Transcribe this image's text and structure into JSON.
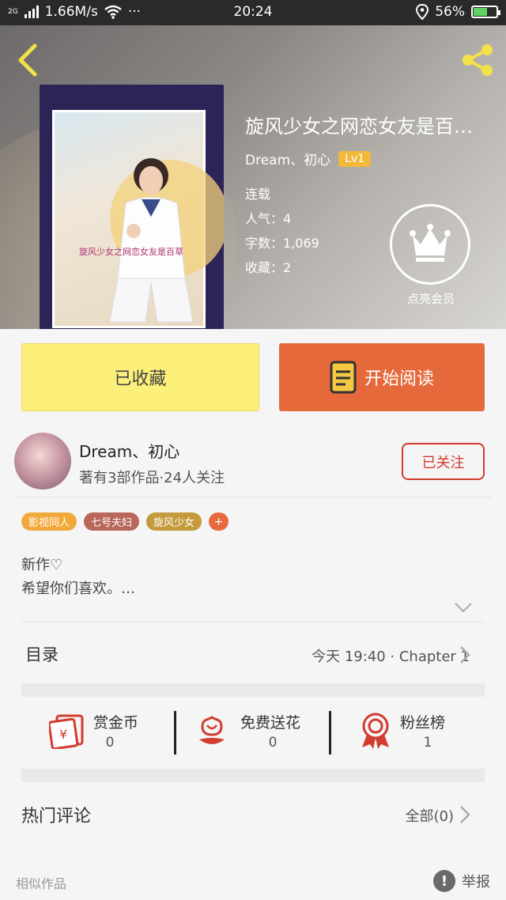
{
  "status_bar": {
    "network": "2G",
    "speed": "1.66M/s",
    "more": "···",
    "time": "20:24",
    "battery": "56%"
  },
  "book": {
    "title": "旋风少女之网恋女友是百…",
    "author": "Dream、初心",
    "level": "Lv1",
    "status": "连载",
    "popularity": "人气：4",
    "word_count": "字数：1,069",
    "favorites": "收藏：2",
    "cover_caption": "旋风少女之网恋女友是百草"
  },
  "vip": {
    "label": "点亮会员"
  },
  "actions": {
    "collect_label": "已收藏",
    "read_label": "开始阅读"
  },
  "author_card": {
    "name": "Dream、初心",
    "info": "著有3部作品·24人关注",
    "follow_label": "已关注"
  },
  "tags": [
    {
      "label": "影视同人",
      "color": "#f2a93b"
    },
    {
      "label": "七号夫妇",
      "color": "#b8675a"
    },
    {
      "label": "旋风少女",
      "color": "#c59a3c"
    }
  ],
  "tag_add": "+",
  "description": {
    "line1": "新作♡",
    "line2": "希望你们喜欢。…"
  },
  "toc": {
    "label": "目录",
    "latest": "今天 19:40 · Chapter 1"
  },
  "gifts": [
    {
      "label": "赏金币",
      "count": "0",
      "icon": "red-envelope-icon"
    },
    {
      "label": "免费送花",
      "count": "0",
      "icon": "flower-icon"
    },
    {
      "label": "粉丝榜",
      "count": "1",
      "icon": "medal-icon"
    }
  ],
  "comments": {
    "label": "热门评论",
    "all": "全部(0)"
  },
  "footer": {
    "similar": "相似作品",
    "report": "举报"
  },
  "colors": {
    "accent_orange": "#e6693c",
    "collect_yellow": "#fdf07a",
    "follow_red": "#d33b2e",
    "lvl_badge": "#f2b83a"
  }
}
